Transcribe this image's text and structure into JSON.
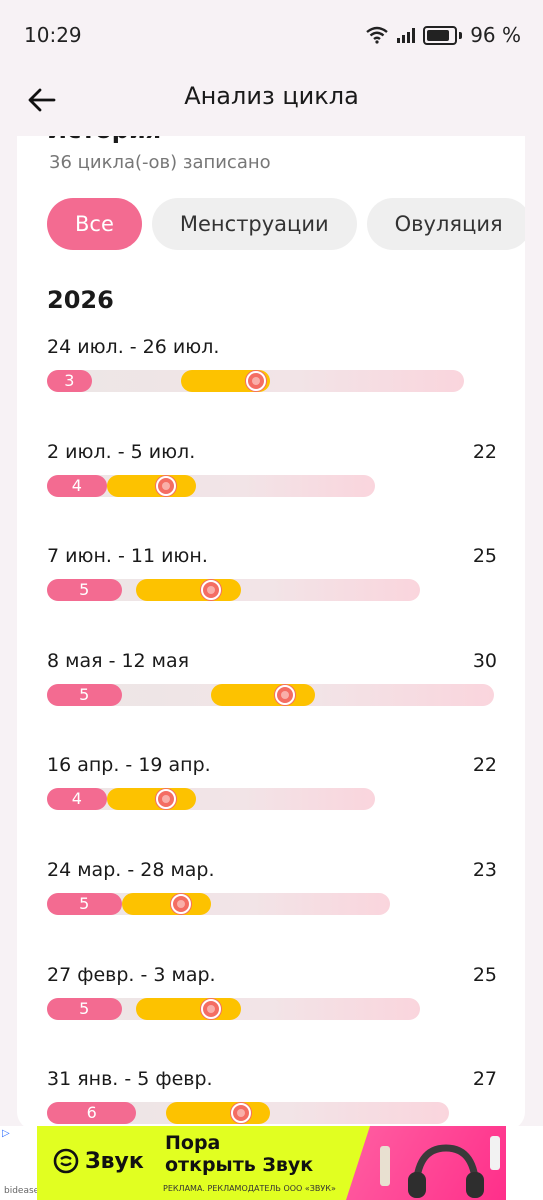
{
  "status": {
    "time": "10:29",
    "battery": "96 %"
  },
  "header": {
    "title": "Анализ цикла"
  },
  "history": {
    "title": "История",
    "count": "36 цикла(-ов) записано",
    "filters": [
      "Все",
      "Менструации",
      "Овуляция"
    ],
    "active_filter": "Все",
    "year": "2026",
    "cycles": [
      {
        "dates": "24 июл. - 26 июл.",
        "length": "",
        "period_days": "3",
        "cycle_days": 28,
        "fertile_start": 9,
        "fertile_end": 15,
        "ovulation": 14
      },
      {
        "dates": "2 июл. - 5 июл.",
        "length": "22",
        "period_days": "4",
        "cycle_days": 22,
        "fertile_start": 4,
        "fertile_end": 10,
        "ovulation": 8
      },
      {
        "dates": "7 июн. - 11 июн.",
        "length": "25",
        "period_days": "5",
        "cycle_days": 25,
        "fertile_start": 6,
        "fertile_end": 13,
        "ovulation": 11
      },
      {
        "dates": "8 мая - 12 мая",
        "length": "30",
        "period_days": "5",
        "cycle_days": 30,
        "fertile_start": 11,
        "fertile_end": 18,
        "ovulation": 16
      },
      {
        "dates": "16 апр. - 19 апр.",
        "length": "22",
        "period_days": "4",
        "cycle_days": 22,
        "fertile_start": 4,
        "fertile_end": 10,
        "ovulation": 8
      },
      {
        "dates": "24 мар. - 28 мар.",
        "length": "23",
        "period_days": "5",
        "cycle_days": 23,
        "fertile_start": 5,
        "fertile_end": 11,
        "ovulation": 9
      },
      {
        "dates": "27 февр. - 3 мар.",
        "length": "25",
        "period_days": "5",
        "cycle_days": 25,
        "fertile_start": 6,
        "fertile_end": 13,
        "ovulation": 11
      },
      {
        "dates": "31 янв. - 5 февр.",
        "length": "27",
        "period_days": "6",
        "cycle_days": 27,
        "fertile_start": 8,
        "fertile_end": 15,
        "ovulation": 13
      }
    ]
  },
  "ad": {
    "brand": "Звук",
    "headline_line1": "Пора",
    "headline_line2": "открыть Звук",
    "legal": "РЕКЛАМА. РЕКЛАМОДАТЕЛЬ ООО «ЗВУК»",
    "network": "bidease"
  },
  "colors": {
    "period": "#f36b91",
    "fertile": "#fdc200",
    "ovulation": "#f46d63",
    "ad_background": "#e1ff21"
  }
}
